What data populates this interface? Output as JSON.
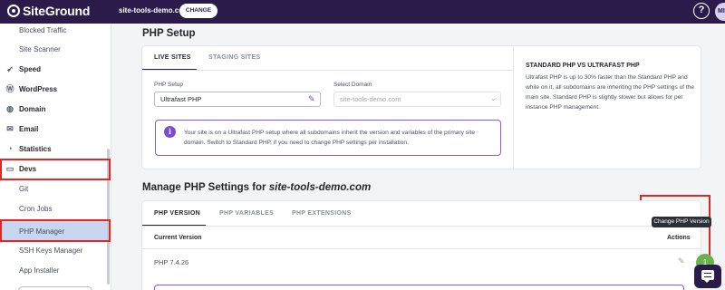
{
  "topbar": {
    "logo_text": "SiteGround",
    "site_name": "site-tools-demo.com",
    "change_label": "CHANGE",
    "help_icon": "question-circle-icon",
    "avatar_initials": "MI"
  },
  "sidebar": {
    "items": [
      {
        "label": "Blocked Traffic",
        "type": "sub"
      },
      {
        "label": "Site Scanner",
        "type": "sub"
      },
      {
        "label": "Speed",
        "type": "section",
        "icon": "rocket-icon"
      },
      {
        "label": "WordPress",
        "type": "section",
        "icon": "wordpress-icon"
      },
      {
        "label": "Domain",
        "type": "section",
        "icon": "globe-icon"
      },
      {
        "label": "Email",
        "type": "section",
        "icon": "envelope-icon"
      },
      {
        "label": "Statistics",
        "type": "section",
        "icon": "pie-chart-icon"
      },
      {
        "label": "Devs",
        "type": "section",
        "icon": "code-window-icon"
      },
      {
        "label": "Git",
        "type": "sub"
      },
      {
        "label": "Cron Jobs",
        "type": "sub"
      },
      {
        "label": "PHP Manager",
        "type": "sub",
        "active": true
      },
      {
        "label": "SSH Keys Manager",
        "type": "sub"
      },
      {
        "label": "App Installer",
        "type": "sub"
      }
    ]
  },
  "php_setup": {
    "title": "PHP Setup",
    "tabs": [
      "LIVE SITES",
      "STAGING SITES"
    ],
    "php_setup_label": "PHP Setup",
    "php_setup_value": "Ultrafast PHP",
    "select_domain_label": "Select Domain",
    "select_domain_value": "site-tools-demo.com",
    "notice": "Your site is on a Ultrafast PHP setup where all subdomains inherit the version and variables of the primary site domain. Switch to Standard PHP, if you need to change PHP settings per installation.",
    "info_title": "STANDARD PHP VS ULTRAFAST PHP",
    "info_text": "Ultrafast PHP is up to 30% faster than the Standard PHP and while on it, all subdomains are inheriting the PHP settings of the main site. Standard PHP is slightly slower but allows for per instance PHP management."
  },
  "manage": {
    "title_prefix": "Manage PHP Settings for",
    "title_domain": "site-tools-demo.com",
    "tabs": [
      "PHP VERSION",
      "PHP VARIABLES",
      "PHP EXTENSIONS"
    ],
    "col_current": "Current Version",
    "col_actions": "Actions",
    "row_version": "PHP 7.4.26",
    "tooltip": "Change PHP Version",
    "chat_badge": "1"
  },
  "colors": {
    "brand": "#2a1b4a",
    "accent": "#7d4ad2",
    "highlight": "#e02626",
    "active_bg": "#c9d6f2"
  }
}
